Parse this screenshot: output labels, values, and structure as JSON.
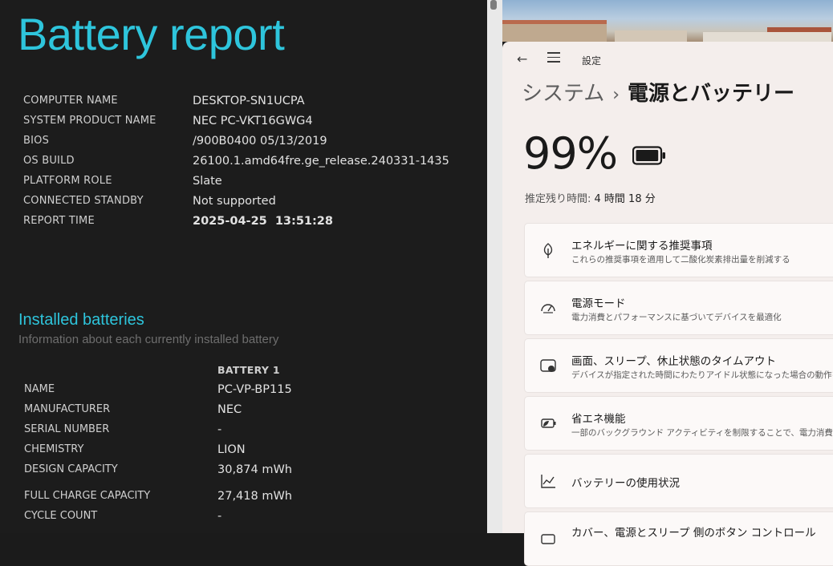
{
  "report": {
    "title": "Battery report",
    "system_info": [
      {
        "label": "COMPUTER NAME",
        "value": "DESKTOP-SN1UCPA"
      },
      {
        "label": "SYSTEM PRODUCT NAME",
        "value": "NEC PC-VKT16GWG4"
      },
      {
        "label": "BIOS",
        "value": "/900B0400 05/13/2019"
      },
      {
        "label": "OS BUILD",
        "value": "26100.1.amd64fre.ge_release.240331-1435"
      },
      {
        "label": "PLATFORM ROLE",
        "value": "Slate"
      },
      {
        "label": "CONNECTED STANDBY",
        "value": "Not supported"
      },
      {
        "label": "REPORT TIME",
        "value": "2025-04-25  13:51:28"
      }
    ],
    "installed_title": "Installed batteries",
    "installed_subtitle": "Information about each currently installed battery",
    "battery_column": "BATTERY 1",
    "battery_rows": [
      {
        "label": "NAME",
        "value": "PC-VP-BP115"
      },
      {
        "label": "MANUFACTURER",
        "value": "NEC"
      },
      {
        "label": "SERIAL NUMBER",
        "value": "-"
      },
      {
        "label": "CHEMISTRY",
        "value": "LION"
      },
      {
        "label": "DESIGN CAPACITY",
        "value": "30,874 mWh"
      },
      {
        "label": "FULL CHARGE CAPACITY",
        "value": "27,418 mWh"
      },
      {
        "label": "CYCLE COUNT",
        "value": "-"
      }
    ]
  },
  "settings": {
    "app_title": "設定",
    "breadcrumb_parent": "システム",
    "breadcrumb_sep": "›",
    "breadcrumb_current": "電源とバッテリー",
    "battery_percent": "99%",
    "battery_level": 0.99,
    "remaining_label": "推定残り時間: ",
    "remaining_value": "4 時間 18 分",
    "cards": [
      {
        "icon": "leaf-icon",
        "title": "エネルギーに関する推奨事項",
        "subtitle": "これらの推奨事項を適用して二酸化炭素排出量を削減する"
      },
      {
        "icon": "gauge-icon",
        "title": "電源モード",
        "subtitle": "電力消費とパフォーマンスに基づいてデバイスを最適化"
      },
      {
        "icon": "screen-sleep-icon",
        "title": "画面、スリープ、休止状態のタイムアウト",
        "subtitle": "デバイスが指定された時間にわたりアイドル状態になった場合の動作を"
      },
      {
        "icon": "battery-saver-icon",
        "title": "省エネ機能",
        "subtitle": "一部のバックグラウンド アクティビティを制限することで、電力消費を削"
      },
      {
        "icon": "chart-icon",
        "title": "バッテリーの使用状況",
        "subtitle": ""
      },
      {
        "icon": "power-button-icon",
        "title": "カバー、電源とスリープ 側のボタン コントロール",
        "subtitle": ""
      }
    ]
  }
}
